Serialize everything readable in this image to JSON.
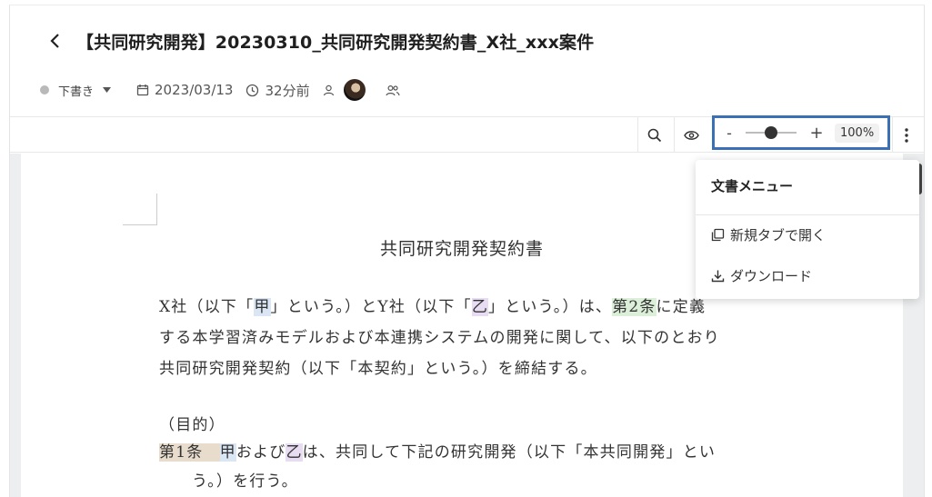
{
  "header": {
    "title": "【共同研究開発】20230310_共同研究開発契約書_X社_xxx案件",
    "status_label": "下書き",
    "date": "2023/03/13",
    "time_ago": "32分前"
  },
  "toolbar": {
    "zoom_minus": "-",
    "zoom_plus": "+",
    "zoom_value": "100%",
    "zoom_level_fraction": 0.5
  },
  "document": {
    "heading": "共同研究開発契約書",
    "p1_a": "X社（以下「",
    "p1_b": "甲",
    "p1_c": "」という。）とY社（以下「",
    "p1_d": "乙",
    "p1_e": "」という。）は、",
    "p1_f": "第2条",
    "p1_g": "に定義",
    "p1_line2": "する本学習済みモデルおよび本連携システムの開発に関して、以下のとおり",
    "p1_line3": "共同研究開発契約（以下「本契約」という。）を締結する。",
    "purpose": "（目的）",
    "art1_a": "第1条",
    "art1_b": "甲",
    "art1_c": "および",
    "art1_d": "乙",
    "art1_e": "は、共同して下記の研究開発（以下「本共同開発」とい",
    "art1_line2": "う。）を行う。"
  },
  "menu": {
    "title": "文書メニュー",
    "open_new_tab": "新規タブで開く",
    "download": "ダウンロード"
  },
  "colors": {
    "zoom_highlight": "#3b6fb6",
    "hl_party_a": "#dbe6f5",
    "hl_party_b": "#e7dcf2",
    "hl_article_ref": "#dcefd9",
    "hl_article": "#e8dccd"
  }
}
